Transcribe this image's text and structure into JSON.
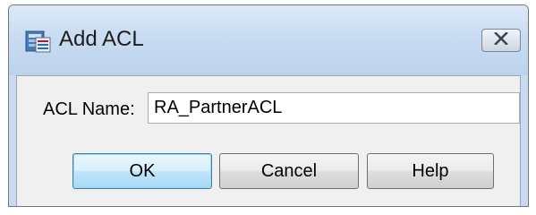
{
  "window": {
    "title": "Add ACL",
    "app_icon": "asdm-app-icon",
    "close_icon": "close-icon"
  },
  "form": {
    "acl_name_label": "ACL Name:",
    "acl_name_value": "RA_PartnerACL"
  },
  "buttons": {
    "ok": "OK",
    "cancel": "Cancel",
    "help": "Help"
  }
}
